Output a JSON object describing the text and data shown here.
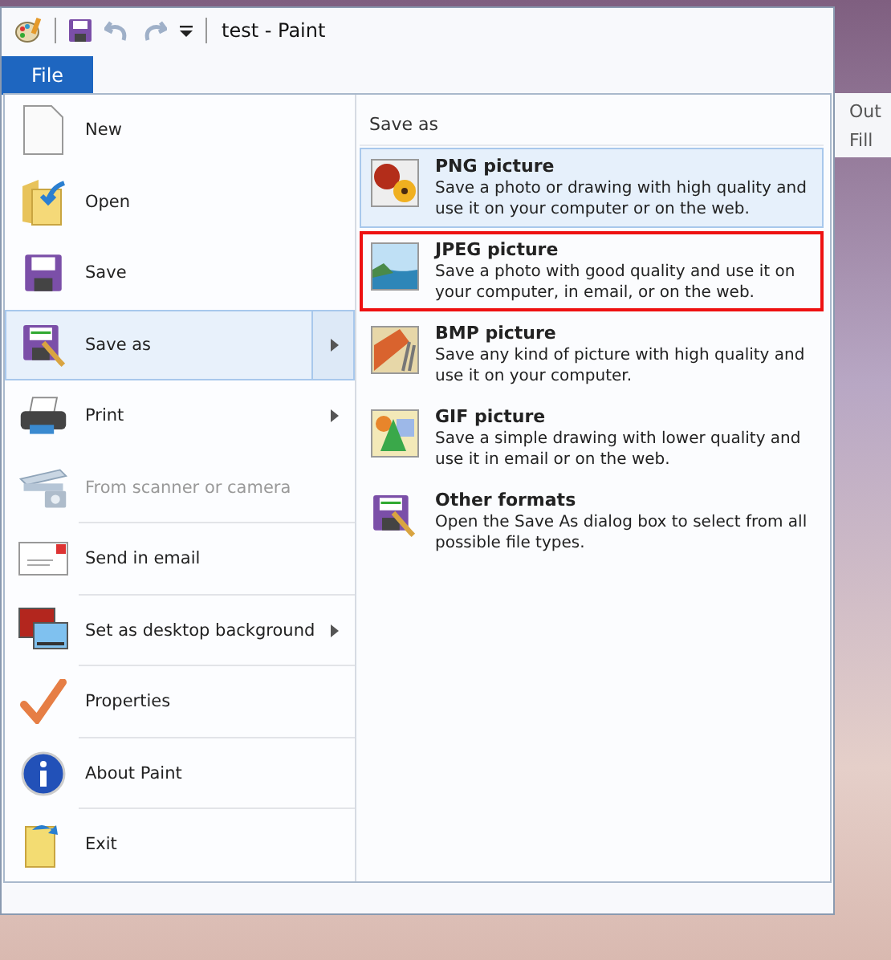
{
  "window": {
    "title": "test - Paint"
  },
  "file_tab": {
    "label": "File",
    "selected": true
  },
  "ribbon_remnants": [
    "Out",
    "Fill"
  ],
  "menu": {
    "items": [
      {
        "kind": "new",
        "label": "New",
        "selected": false,
        "disabled": false,
        "submenu": false
      },
      {
        "kind": "open",
        "label": "Open",
        "selected": false,
        "disabled": false,
        "submenu": false
      },
      {
        "kind": "save",
        "label": "Save",
        "selected": false,
        "disabled": false,
        "submenu": false
      },
      {
        "kind": "saveas",
        "label": "Save as",
        "selected": true,
        "disabled": false,
        "submenu": true
      },
      {
        "kind": "print",
        "label": "Print",
        "selected": false,
        "disabled": false,
        "submenu": true
      },
      {
        "kind": "scanner",
        "label": "From scanner or camera",
        "selected": false,
        "disabled": true,
        "submenu": false
      },
      {
        "kind": "email",
        "label": "Send in email",
        "selected": false,
        "disabled": false,
        "submenu": false
      },
      {
        "kind": "desktop",
        "label": "Set as desktop background",
        "selected": false,
        "disabled": false,
        "submenu": true
      },
      {
        "kind": "properties",
        "label": "Properties",
        "selected": false,
        "disabled": false,
        "submenu": false
      },
      {
        "kind": "about",
        "label": "About Paint",
        "selected": false,
        "disabled": false,
        "submenu": false
      },
      {
        "kind": "exit",
        "label": "Exit",
        "selected": false,
        "disabled": false,
        "submenu": false
      }
    ]
  },
  "save_as_pane": {
    "heading": "Save as",
    "options": [
      {
        "kind": "png",
        "title": "PNG picture",
        "description": "Save a photo or drawing with high quality and use it on your computer or on the web.",
        "selected": true,
        "outlined": false
      },
      {
        "kind": "jpeg",
        "title": "JPEG picture",
        "description": "Save a photo with good quality and use it on your computer, in email, or on the web.",
        "selected": false,
        "outlined": true
      },
      {
        "kind": "bmp",
        "title": "BMP picture",
        "description": "Save any kind of picture with high quality and use it on your computer.",
        "selected": false,
        "outlined": false
      },
      {
        "kind": "gif",
        "title": "GIF picture",
        "description": "Save a simple drawing with lower quality and use it in email or on the web.",
        "selected": false,
        "outlined": false
      },
      {
        "kind": "other",
        "title": "Other formats",
        "description": "Open the Save As dialog box to select from all possible file types.",
        "selected": false,
        "outlined": false
      }
    ]
  }
}
